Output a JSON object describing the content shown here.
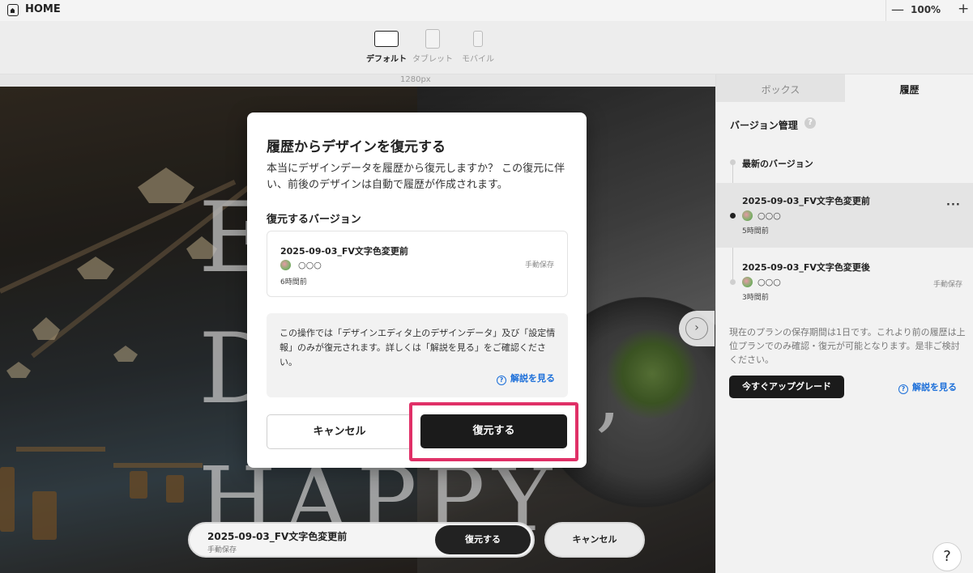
{
  "header": {
    "title": "HOME",
    "zoom": "100%",
    "zoom_minus": "—",
    "zoom_plus": "+"
  },
  "devices": [
    {
      "label": "デフォルト",
      "active": true
    },
    {
      "label": "タブレット",
      "active": false
    },
    {
      "label": "モバイル",
      "active": false
    }
  ],
  "ruler": {
    "width_label": "1280px"
  },
  "canvas": {
    "hero_letters": [
      "E",
      "D",
      "HAPPY",
      ","
    ]
  },
  "right_panel": {
    "tabs": [
      "ボックス",
      "履歴"
    ],
    "version_title": "バージョン管理",
    "help_mark": "?",
    "latest_label": "最新のバージョン",
    "items": [
      {
        "name": "2025-09-03_FV文字色変更前",
        "user": "○○○",
        "time": "5時間前",
        "more": "···",
        "save_type": ""
      },
      {
        "name": "2025-09-03_FV文字色変更後",
        "user": "○○○",
        "time": "3時間前",
        "more": "",
        "save_type": "手動保存"
      }
    ],
    "plan_note": "現在のプランの保存期間は1日です。これより前の履歴は上位プランでのみ確認・復元が可能となります。是非ご検討ください。",
    "upgrade_label": "今すぐアップグレード",
    "help_link": "解説を見る"
  },
  "bottom_bar": {
    "version_name": "2025-09-03_FV文字色変更前",
    "save_type": "手動保存",
    "restore_label": "復元する",
    "cancel_label": "キャンセル"
  },
  "fab": {
    "help": "?",
    "next": "›"
  },
  "modal": {
    "title": "履歴からデザインを復元する",
    "description": "本当にデザインデータを履歴から復元しますか？ この復元に伴い、前後のデザインは自動で履歴が作成されます。",
    "section_label": "復元するバージョン",
    "version": {
      "name": "2025-09-03_FV文字色変更前",
      "user": "○○○",
      "save_type": "手動保存",
      "time": "6時間前"
    },
    "info_text": "この操作では「デザインエディタ上のデザインデータ」及び「設定情報」のみが復元されます。詳しくは「解説を見る」をご確認ください。",
    "info_link": "解説を見る",
    "cancel_label": "キャンセル",
    "restore_label": "復元する"
  },
  "colors": {
    "accent_highlight": "#e03067",
    "link": "#1c6fd9",
    "primary_button": "#1b1b1b"
  }
}
